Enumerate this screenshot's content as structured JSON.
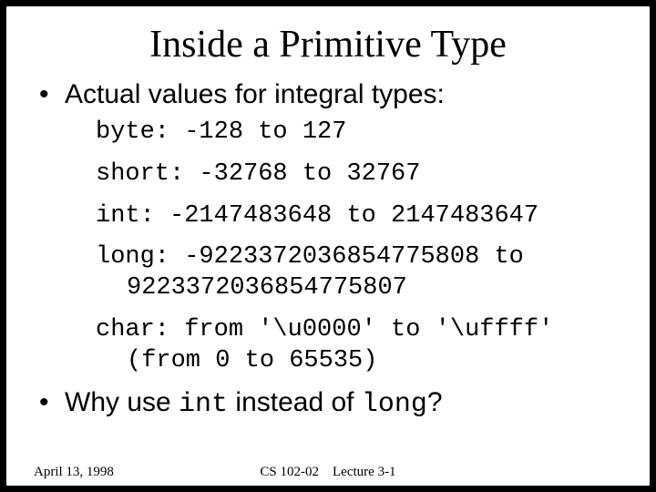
{
  "title": "Inside a Primitive Type",
  "bullet1": "Actual values for integral types:",
  "ranges": {
    "byte": "byte:  -128 to 127",
    "short": "short: -32768 to 32767",
    "int": "int: -2147483648 to 2147483647",
    "long_line1": "long: -9223372036854775808 to",
    "long_line2": "9223372036854775807",
    "char_line1": "char: from '\\u0000' to '\\uffff'",
    "char_line2": "(from 0 to 65535)"
  },
  "bullet2": {
    "pre": "Why use ",
    "mono1": "int",
    "mid": " instead of ",
    "mono2": "long",
    "post": "?"
  },
  "footer": {
    "date": "April 13, 1998",
    "course": "CS 102-02",
    "lecture": "Lecture 3-1"
  }
}
